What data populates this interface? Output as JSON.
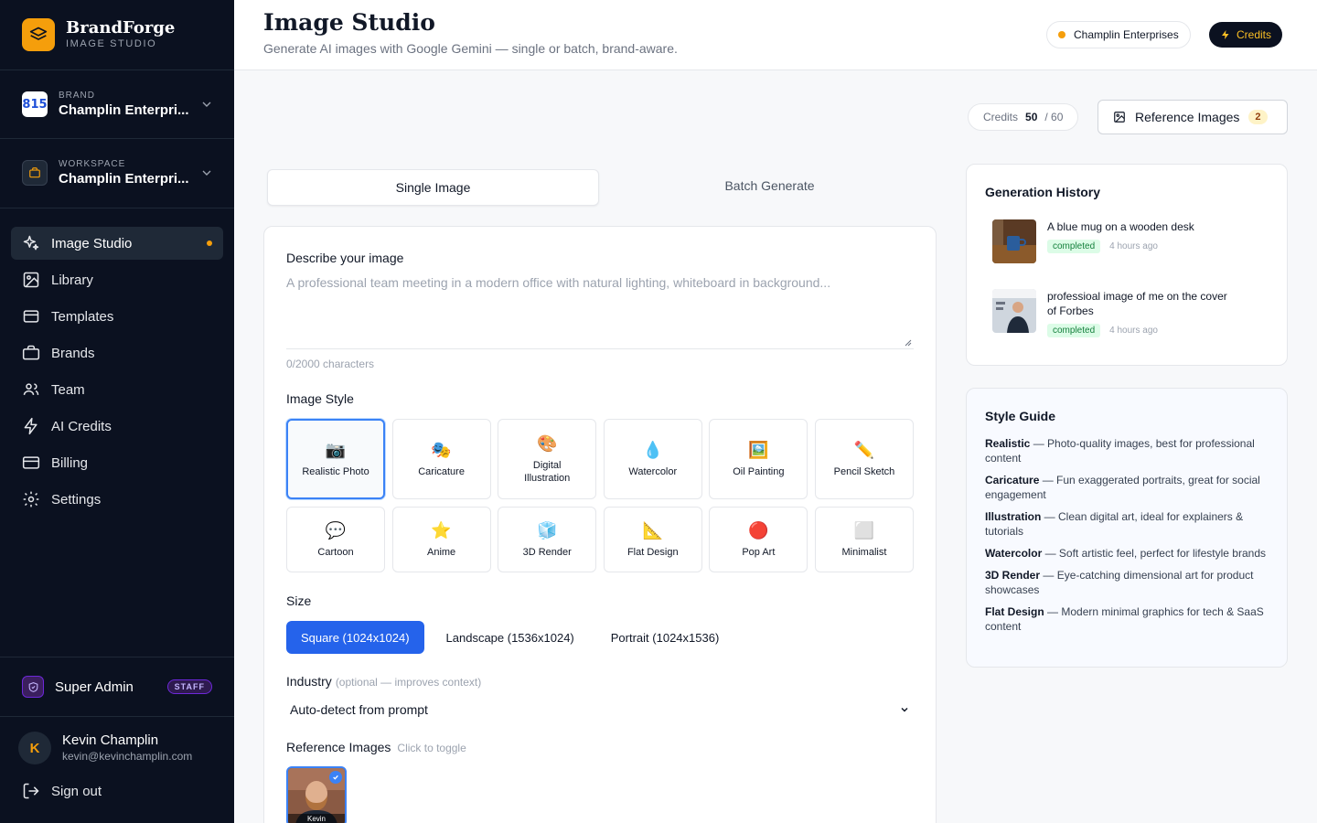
{
  "app": {
    "name": "BrandForge",
    "subtitle": "IMAGE STUDIO"
  },
  "brand_selector": {
    "label": "BRAND",
    "value": "Champlin Enterpri...",
    "logo_text": "815"
  },
  "workspace_selector": {
    "label": "WORKSPACE",
    "value": "Champlin Enterpri..."
  },
  "nav": [
    {
      "label": "Image Studio",
      "icon": "sparkles-icon",
      "active": true
    },
    {
      "label": "Library",
      "icon": "image-icon"
    },
    {
      "label": "Templates",
      "icon": "template-icon"
    },
    {
      "label": "Brands",
      "icon": "briefcase-icon"
    },
    {
      "label": "Team",
      "icon": "users-icon"
    },
    {
      "label": "AI Credits",
      "icon": "bolt-icon"
    },
    {
      "label": "Billing",
      "icon": "credit-card-icon"
    },
    {
      "label": "Settings",
      "icon": "gear-icon"
    }
  ],
  "admin": {
    "label": "Super Admin",
    "badge": "STAFF"
  },
  "user": {
    "initial": "K",
    "name": "Kevin Champlin",
    "email": "kevin@kevinchamplin.com",
    "signout": "Sign out"
  },
  "header": {
    "title": "Image Studio",
    "subtitle": "Generate AI images with Google Gemini — single or batch, brand-aware.",
    "brand_pill": "Champlin Enterprises",
    "credits_button": "Credits"
  },
  "credits_chip": {
    "label": "Credits",
    "value": "50",
    "total": "/ 60"
  },
  "reference_button": {
    "label": "Reference Images",
    "count": "2"
  },
  "tabs": [
    {
      "label": "Single Image",
      "active": true
    },
    {
      "label": "Batch Generate"
    }
  ],
  "prompt": {
    "label": "Describe your image",
    "placeholder": "A professional team meeting in a modern office with natural lighting, whiteboard in background...",
    "char_count": "0/2000 characters"
  },
  "image_style": {
    "label": "Image Style",
    "options": [
      {
        "label": "Realistic Photo",
        "emoji": "📷",
        "selected": true
      },
      {
        "label": "Caricature",
        "emoji": "🎭"
      },
      {
        "label": "Digital Illustration",
        "emoji": "🎨"
      },
      {
        "label": "Watercolor",
        "emoji": "💧"
      },
      {
        "label": "Oil Painting",
        "emoji": "🖼️"
      },
      {
        "label": "Pencil Sketch",
        "emoji": "✏️"
      },
      {
        "label": "Cartoon",
        "emoji": "💬"
      },
      {
        "label": "Anime",
        "emoji": "⭐"
      },
      {
        "label": "3D Render",
        "emoji": "🧊"
      },
      {
        "label": "Flat Design",
        "emoji": "📐"
      },
      {
        "label": "Pop Art",
        "emoji": "🔴"
      },
      {
        "label": "Minimalist",
        "emoji": "⬜"
      }
    ]
  },
  "size": {
    "label": "Size",
    "options": [
      {
        "label": "Square (1024x1024)",
        "active": true
      },
      {
        "label": "Landscape (1536x1024)"
      },
      {
        "label": "Portrait (1024x1536)"
      }
    ]
  },
  "industry": {
    "label": "Industry",
    "hint": "(optional — improves context)",
    "value": "Auto-detect from prompt"
  },
  "reference_images": {
    "label": "Reference Images",
    "hint": "Click to toggle",
    "items": [
      {
        "name": "Kevin",
        "selected": true
      }
    ]
  },
  "history": {
    "title": "Generation History",
    "items": [
      {
        "text": "A blue mug on a wooden desk",
        "status": "completed",
        "time": "4 hours ago"
      },
      {
        "text": "professioal image of me on the cover of Forbes",
        "status": "completed",
        "time": "4 hours ago"
      }
    ]
  },
  "style_guide": {
    "title": "Style Guide",
    "items": [
      {
        "name": "Realistic",
        "desc": " — Photo-quality images, best for professional content"
      },
      {
        "name": "Caricature",
        "desc": " — Fun exaggerated portraits, great for social engagement"
      },
      {
        "name": "Illustration",
        "desc": " — Clean digital art, ideal for explainers & tutorials"
      },
      {
        "name": "Watercolor",
        "desc": " — Soft artistic feel, perfect for lifestyle brands"
      },
      {
        "name": "3D Render",
        "desc": " — Eye-catching dimensional art for product showcases"
      },
      {
        "name": "Flat Design",
        "desc": " — Modern minimal graphics for tech & SaaS content"
      }
    ]
  },
  "colors": {
    "accent": "#f59e0b",
    "primary": "#2563eb",
    "sidebar_bg": "#0b1120"
  }
}
